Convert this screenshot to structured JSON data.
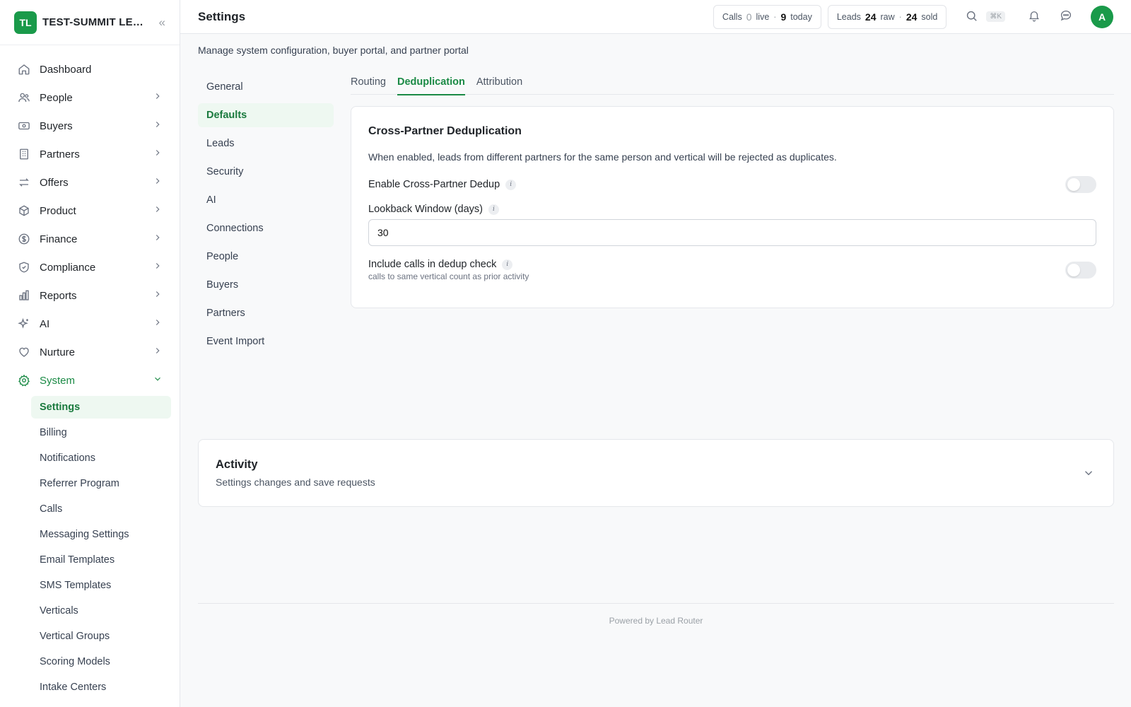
{
  "brand": {
    "initials": "TL",
    "name": "TEST-SUMMIT LEAD..."
  },
  "nav": [
    {
      "label": "Dashboard"
    },
    {
      "label": "People"
    },
    {
      "label": "Buyers"
    },
    {
      "label": "Partners"
    },
    {
      "label": "Offers"
    },
    {
      "label": "Product"
    },
    {
      "label": "Finance"
    },
    {
      "label": "Compliance"
    },
    {
      "label": "Reports"
    },
    {
      "label": "AI"
    },
    {
      "label": "Nurture"
    },
    {
      "label": "System"
    }
  ],
  "system_sub": [
    "Settings",
    "Billing",
    "Notifications",
    "Referrer Program",
    "Calls",
    "Messaging Settings",
    "Email Templates",
    "SMS Templates",
    "Verticals",
    "Vertical Groups",
    "Scoring Models",
    "Intake Centers"
  ],
  "header": {
    "title": "Settings",
    "calls": {
      "label": "Calls",
      "live": "0",
      "live_label": "live",
      "today": "9",
      "today_label": "today"
    },
    "leads": {
      "label": "Leads",
      "raw": "24",
      "raw_label": "raw",
      "sold": "24",
      "sold_label": "sold"
    },
    "shortcut": "⌘K",
    "avatar": "A"
  },
  "page": {
    "subtitle": "Manage system configuration, buyer portal, and partner portal"
  },
  "settings_nav": [
    "General",
    "Defaults",
    "Leads",
    "Security",
    "AI",
    "Connections",
    "People",
    "Buyers",
    "Partners",
    "Event Import"
  ],
  "tabs": [
    "Routing",
    "Deduplication",
    "Attribution"
  ],
  "card": {
    "title": "Cross-Partner Deduplication",
    "description": "When enabled, leads from different partners for the same person and vertical will be rejected as duplicates.",
    "enable_label": "Enable Cross-Partner Dedup",
    "lookback_label": "Lookback Window (days)",
    "lookback_value": "30",
    "include_calls_label": "Include calls in dedup check",
    "include_calls_hint": "calls to same vertical count as prior activity",
    "enable_on": false,
    "include_calls_on": false
  },
  "activity": {
    "title": "Activity",
    "subtitle": "Settings changes and save requests"
  },
  "footer": "Powered by Lead Router",
  "colors": {
    "accent": "#1a8a45",
    "brand": "#1a9a4a"
  }
}
